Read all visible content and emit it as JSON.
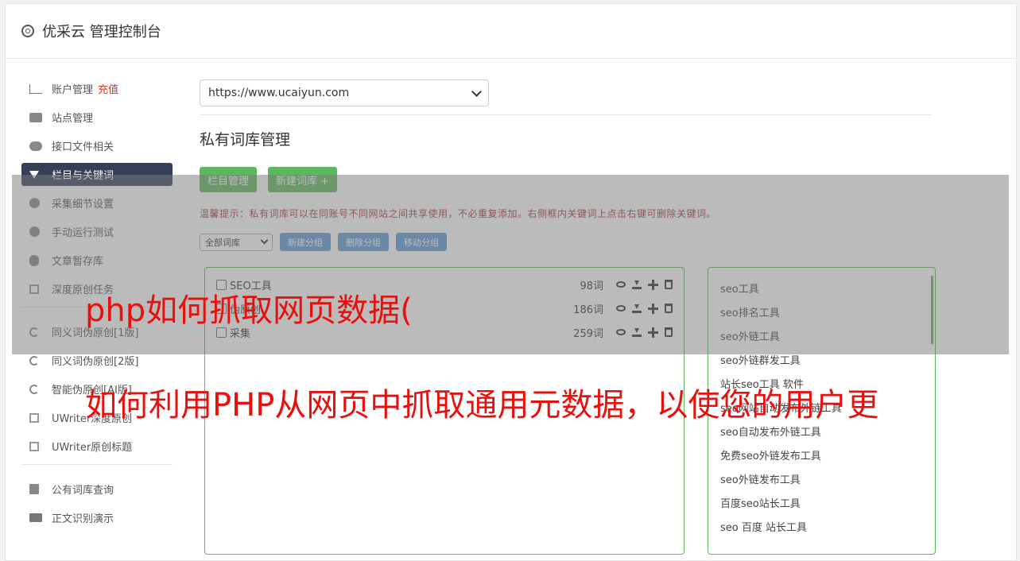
{
  "header": {
    "title": "优采云 管理控制台"
  },
  "sidebar": {
    "items": [
      {
        "label": "账户管理",
        "extra": "充值",
        "icon": "bar-chart-icon"
      },
      {
        "label": "站点管理",
        "icon": "server-icon"
      },
      {
        "label": "接口文件相关",
        "icon": "cloud-upload-icon"
      },
      {
        "label": "栏目与关键词",
        "icon": "filter-icon",
        "active": true
      },
      {
        "label": "采集细节设置",
        "icon": "gears-icon"
      },
      {
        "label": "手动运行测试",
        "icon": "play-circle-icon"
      },
      {
        "label": "文章暂存库",
        "icon": "database-icon"
      },
      {
        "label": "深度原创任务",
        "icon": "edit-icon"
      }
    ],
    "items2": [
      {
        "label": "同义词伪原创[1版]",
        "icon": "refresh-icon"
      },
      {
        "label": "同义词伪原创[2版]",
        "icon": "refresh-icon"
      },
      {
        "label": "智能伪原创[AI版]",
        "icon": "refresh-icon"
      },
      {
        "label": "UWriter深度原创",
        "icon": "edit-icon"
      },
      {
        "label": "UWriter原创标题",
        "icon": "edit-icon"
      }
    ],
    "items3": [
      {
        "label": "公有词库查询",
        "icon": "book-icon"
      },
      {
        "label": "正文识别演示",
        "icon": "monitor-icon"
      }
    ]
  },
  "main": {
    "site_select": "https://www.ucaiyun.com",
    "page_title": "私有词库管理",
    "btn_column": "栏目管理",
    "btn_new_lib": "新建词库 +",
    "tip": "温馨提示：私有词库可以在同账号不同网站之间共享使用，不必重复添加。右侧框内关键词上点击右键可删除关键词。",
    "group_select": "全部词库",
    "btn_new_group": "新建分组",
    "btn_delete_group": "删除分组",
    "btn_move_group": "移动分组",
    "groups": [
      {
        "name": "SEO工具",
        "count": "98词"
      },
      {
        "name": "伪原创",
        "count": "186词"
      },
      {
        "name": "采集",
        "count": "259词"
      }
    ],
    "keywords": [
      "seo工具",
      "seo排名工具",
      "seo外链工具",
      "seo外链群发工具",
      "站长seo工具 软件",
      "seo网站自动发布外链工具",
      "seo自动发布外链工具",
      "免费seo外链发布工具",
      "seo外链发布工具",
      "百度seo站长工具",
      "seo 百度 站长工具"
    ]
  },
  "overlay": {
    "line1": "php如何抓取网页数据(",
    "line2": "如何利用PHP从网页中抓取通用元数据，以使您的用户更"
  },
  "colors": {
    "accent_green": "#5cb85c",
    "accent_blue": "#5b9bd5",
    "active_nav": "#344058",
    "overlay_text": "#e8100c"
  }
}
